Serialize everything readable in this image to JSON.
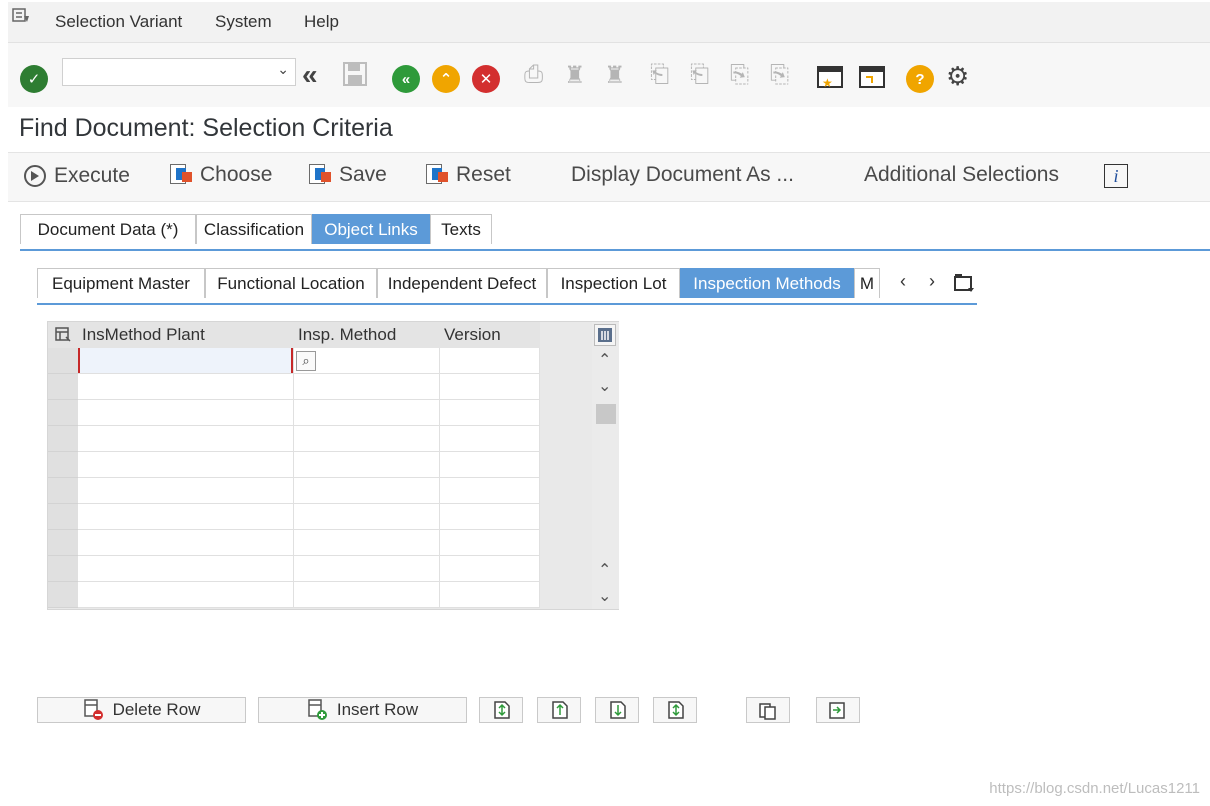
{
  "menu": {
    "items": [
      "Selection Variant",
      "System",
      "Help"
    ]
  },
  "toolbar": {
    "command_field_value": "",
    "icons": [
      "enter-icon",
      "back-icon",
      "save-icon",
      "back-nav-icon",
      "exit-icon",
      "cancel-icon",
      "print-icon",
      "find-icon",
      "find-next-icon",
      "first-page-icon",
      "previous-page-icon",
      "next-page-icon",
      "last-page-icon",
      "create-shortcut-icon",
      "new-session-icon",
      "help-icon",
      "settings-icon"
    ],
    "colors": {
      "enter": "#2e7d32",
      "back_nav": "#2e9a3a",
      "exit": "#f0a500",
      "cancel": "#d32f2f",
      "help": "#f0a500"
    }
  },
  "page": {
    "title": "Find Document: Selection Criteria"
  },
  "app_toolbar": {
    "execute": "Execute",
    "choose": "Choose",
    "save": "Save",
    "reset": "Reset",
    "display_as": "Display Document As ...",
    "additional": "Additional Selections",
    "info_icon": "i"
  },
  "tabs": {
    "main": [
      "Document Data (*)",
      "Classification",
      "Object Links",
      "Texts"
    ],
    "main_active": "Object Links",
    "sub": [
      "Equipment Master",
      "Functional Location",
      "Independent Defect",
      "Inspection Lot",
      "Inspection Methods",
      "M"
    ],
    "sub_active": "Inspection Methods"
  },
  "table": {
    "columns": [
      "InsMethod Plant",
      "Insp. Method",
      "Version"
    ]
  },
  "bottom": {
    "delete_row": "Delete Row",
    "insert_row": "Insert Row"
  },
  "watermark": "https://blog.csdn.net/Lucas1211"
}
